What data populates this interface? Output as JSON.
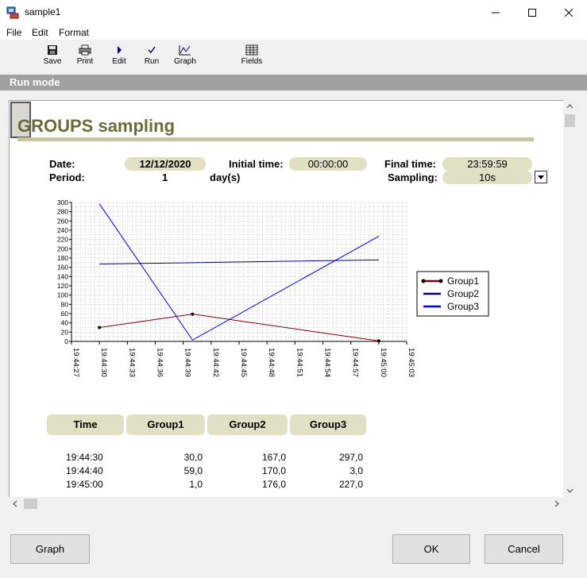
{
  "window": {
    "title": "sample1"
  },
  "menu": {
    "file": "File",
    "edit": "Edit",
    "format": "Format"
  },
  "toolbar": {
    "save": "Save",
    "print": "Print",
    "edit": "Edit",
    "run": "Run",
    "graph": "Graph",
    "fields": "Fields"
  },
  "mode_bar": "Run mode",
  "page": {
    "title": "GROUPS sampling",
    "date_label": "Date:",
    "date_value": "12/12/2020",
    "initial_label": "Initial time:",
    "initial_value": "00:00:00",
    "final_label": "Final time:",
    "final_value": "23:59:59",
    "period_label": "Period:",
    "period_value": "1",
    "period_unit": "day(s)",
    "sampling_label": "Sampling:",
    "sampling_value": "10s"
  },
  "chart_data": {
    "type": "line",
    "y_ticks": [
      "300",
      "280",
      "260",
      "240",
      "220",
      "200",
      "180",
      "160",
      "140",
      "120",
      "100",
      "80",
      "60",
      "40",
      "20",
      "0"
    ],
    "x_ticks": [
      "19:44:27",
      "19:44:30",
      "19:44:33",
      "19:44:36",
      "19:44:39",
      "19:44:42",
      "19:44:45",
      "19:44:48",
      "19:44:51",
      "19:44:54",
      "19:44:57",
      "19:45:00",
      "19:45:03"
    ],
    "ylim": [
      0,
      300
    ],
    "grid": true,
    "legend_position": "right",
    "series": [
      {
        "name": "Group1",
        "color": "#800000",
        "x": [
          "19:44:30",
          "19:44:40",
          "19:45:00"
        ],
        "values": [
          30,
          59,
          1
        ]
      },
      {
        "name": "Group2",
        "color": "#000080",
        "x": [
          "19:44:30",
          "19:44:40",
          "19:45:00"
        ],
        "values": [
          167,
          170,
          176
        ]
      },
      {
        "name": "Group3",
        "color": "#0000ff",
        "x": [
          "19:44:30",
          "19:44:40",
          "19:45:00"
        ],
        "values": [
          297,
          3,
          227
        ]
      }
    ]
  },
  "table": {
    "headers": [
      "Time",
      "Group1",
      "Group2",
      "Group3"
    ],
    "rows": [
      [
        "19:44:30",
        "30,0",
        "167,0",
        "297,0"
      ],
      [
        "19:44:40",
        "59,0",
        "170,0",
        "3,0"
      ],
      [
        "19:45:00",
        "1,0",
        "176,0",
        "227,0"
      ]
    ]
  },
  "buttons": {
    "graph": "Graph",
    "ok": "OK",
    "cancel": "Cancel"
  }
}
